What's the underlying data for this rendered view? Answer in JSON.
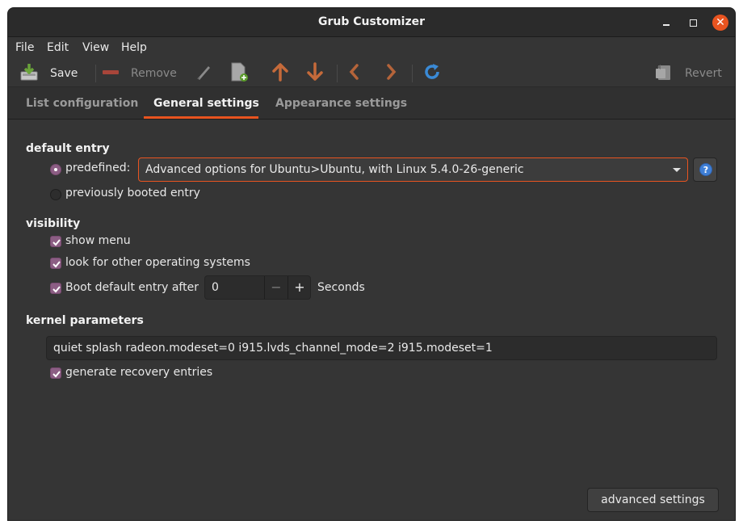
{
  "window": {
    "title": "Grub Customizer"
  },
  "menubar": {
    "items": [
      "File",
      "Edit",
      "View",
      "Help"
    ]
  },
  "toolbar": {
    "save_label": "Save",
    "remove_label": "Remove",
    "revert_label": "Revert",
    "icons": [
      "save-icon",
      "remove-icon",
      "edit-icon",
      "new-entry-icon",
      "move-up-icon",
      "move-down-icon",
      "move-left-icon",
      "move-right-icon",
      "reload-icon",
      "revert-icon"
    ]
  },
  "tabs": [
    {
      "label": "List configuration",
      "active": false
    },
    {
      "label": "General settings",
      "active": true
    },
    {
      "label": "Appearance settings",
      "active": false
    }
  ],
  "default_entry": {
    "heading": "default entry",
    "predefined_label": "predefined:",
    "predefined_selected": true,
    "predefined_value": "Advanced options for Ubuntu>Ubuntu, with Linux 5.4.0-26-generic",
    "previously_booted_label": "previously booted entry",
    "previously_booted_selected": false
  },
  "visibility": {
    "heading": "visibility",
    "show_menu_label": "show menu",
    "show_menu_checked": true,
    "look_for_os_label": "look for other operating systems",
    "look_for_os_checked": true,
    "boot_default_label": "Boot default entry after",
    "boot_default_checked": true,
    "timeout_value": "0",
    "seconds_label": "Seconds"
  },
  "kernel": {
    "heading": "kernel parameters",
    "value": "quiet splash radeon.modeset=0 i915.lvds_channel_mode=2 i915.modeset=1",
    "recovery_label": "generate recovery entries",
    "recovery_checked": true
  },
  "advanced_button_label": "advanced settings",
  "colors": {
    "accent": "#e95420",
    "check": "#8c5e84",
    "background": "#353535"
  }
}
